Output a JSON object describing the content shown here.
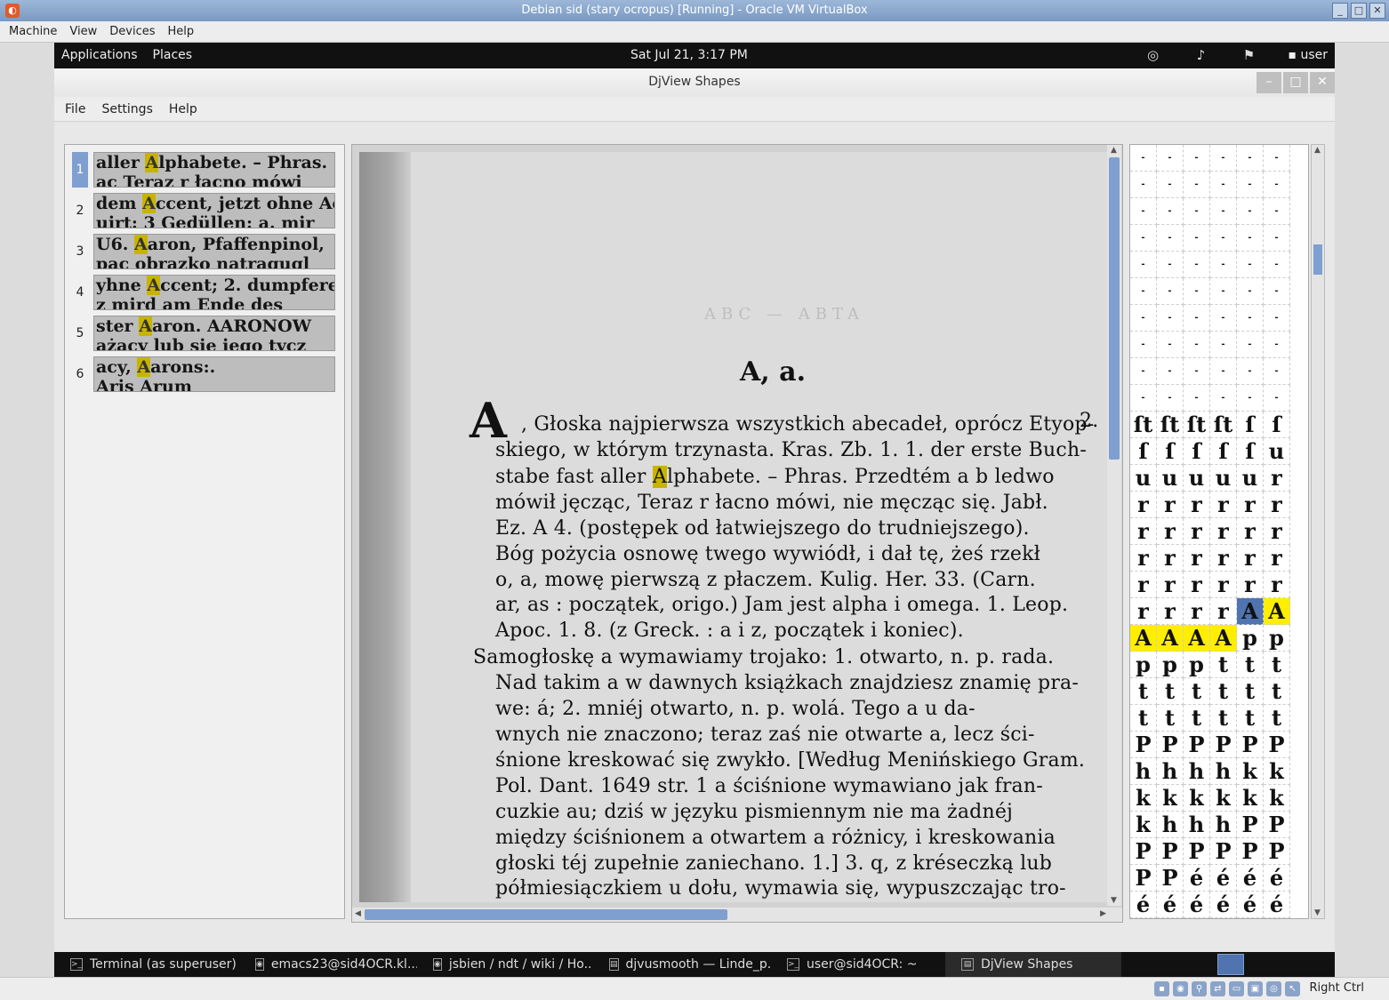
{
  "vbox": {
    "title": "Debian sid (stary ocropus) [Running] - Oracle VM VirtualBox",
    "menu": [
      "Machine",
      "View",
      "Devices",
      "Help"
    ],
    "host_key": "Right Ctrl"
  },
  "gnome": {
    "applications": "Applications",
    "places": "Places",
    "clock": "Sat Jul 21,  3:17 PM",
    "user": "user"
  },
  "window": {
    "title": "DjView Shapes",
    "menu": [
      "File",
      "Settings",
      "Help"
    ]
  },
  "thumbnails": [
    {
      "num": "1",
      "pre": "aller ",
      "hl": "A",
      "post": "lphabete. – Phras.",
      "line2": "ac Teraz r łacno mówi"
    },
    {
      "num": "2",
      "pre": "dem ",
      "hl": "A",
      "post": "ccent, jetzt ohne Ac",
      "line2": "uirt: 3 Gedüllen: a. mir"
    },
    {
      "num": "3",
      "pre": "U6. ",
      "hl": "A",
      "post": "aron, Pfaffenpinol,",
      "line2": "pac obrazko natragugl"
    },
    {
      "num": "4",
      "pre": "yhne ",
      "hl": "A",
      "post": "ccent; 2. dumpferee",
      "line2": "z mird am Ende des"
    },
    {
      "num": "5",
      "pre": "ster ",
      "hl": "A",
      "post": "aron. AARONOW",
      "line2": "ażacy lub sie iego tycz"
    },
    {
      "num": "6",
      "pre": "acy, ",
      "hl": "A",
      "post": "arons:.",
      "line2": " Aris  Arum"
    }
  ],
  "page": {
    "faint_header": "ABC — ABTA",
    "heading": "A, a.",
    "big_initial": "A",
    "side_num": "2.",
    "lines": [
      ", Głoska najpierwsza wszystkich abecadeł, oprócz Etyop-",
      "skiego, w którym trzynasta. Kras. Zb. 1. 1. der erste Buch-",
      "stabe fast aller ",
      "lphabete. – Phras. Przedtém a b ledwo",
      "mówił jęcząc, Teraz r łacno mówi, nie męcząc się. Jabł.",
      "Ez. A 4. (postępek od łatwiejszego do trudniejszego).",
      "Bóg pożycia osnowę twego wywiódł, i dał tę, żeś rzekł",
      "o, a, mowę pierwszą z płaczem. Kulig. Her. 33. (Carn.",
      "ar, as : początek, origo.) Jam jest alpha i omega. 1. Leop.",
      "Apoc. 1. 8. (z Greck. : a i z, początek i koniec).",
      "Samogłoskę a wymawiamy trojako: 1. otwarto, n. p. rada.",
      "Nad takim a w dawnych książkach znajdziesz znamię pra-",
      "we: á; 2. mniéj otwarto, n. p. wolá. Tego a u da-",
      "wnych nie znaczono; teraz zaś nie otwarte a, lecz ści-",
      "śnione kreskować się zwykło. [Według Menińskiego Gram.",
      "Pol. Dant. 1649 str. 1 a ściśnione wymawiano jak fran-",
      "cuzkie au; dziś w języku pismiennym nie ma żadnéj",
      "między ściśnionem a otwartem a różnicy, i kreskowania",
      "głoski téj zupełnie zaniechano. 1.] 3. q, z kréseczką lub",
      "półmiesiączkiem u dołu, wymawia się, wypuszczając tro-"
    ],
    "hl_letter": "A"
  },
  "shapes": {
    "rows": [
      [
        "-",
        "-",
        "-",
        "-",
        "-",
        "-"
      ],
      [
        "-",
        "-",
        "-",
        "-",
        "-",
        "-"
      ],
      [
        "-",
        "-",
        "-",
        "-",
        "-",
        "-"
      ],
      [
        "-",
        "-",
        "-",
        "-",
        "-",
        "-"
      ],
      [
        "-",
        "-",
        "-",
        "-",
        "-",
        "-"
      ],
      [
        "-",
        "-",
        "-",
        "-",
        "-",
        "-"
      ],
      [
        "-",
        "-",
        "-",
        "-",
        "-",
        "-"
      ],
      [
        "-",
        "-",
        "-",
        "-",
        "-",
        "-"
      ],
      [
        "-",
        "-",
        "-",
        "-",
        "-",
        "-"
      ],
      [
        "-",
        "-",
        "-",
        "-",
        "-",
        "-"
      ],
      [
        "ſt",
        "ſt",
        "ſt",
        "ſt",
        "ſ",
        "ſ"
      ],
      [
        "ſ",
        "ſ",
        "ſ",
        "ſ",
        "ſ",
        "u"
      ],
      [
        "u",
        "u",
        "u",
        "u",
        "u",
        "r"
      ],
      [
        "r",
        "r",
        "r",
        "r",
        "r",
        "r"
      ],
      [
        "r",
        "r",
        "r",
        "r",
        "r",
        "r"
      ],
      [
        "r",
        "r",
        "r",
        "r",
        "r",
        "r"
      ],
      [
        "r",
        "r",
        "r",
        "r",
        "r",
        "r"
      ],
      [
        "r",
        "r",
        "r",
        "r",
        "A",
        "A"
      ],
      [
        "A",
        "A",
        "A",
        "A",
        "p",
        "p"
      ],
      [
        "p",
        "p",
        "p",
        "t",
        "t",
        "t"
      ],
      [
        "t",
        "t",
        "t",
        "t",
        "t",
        "t"
      ],
      [
        "t",
        "t",
        "t",
        "t",
        "t",
        "t"
      ],
      [
        "P",
        "P",
        "P",
        "P",
        "P",
        "P"
      ],
      [
        "h",
        "h",
        "h",
        "h",
        "k",
        "k"
      ],
      [
        "k",
        "k",
        "k",
        "k",
        "k",
        "k"
      ],
      [
        "k",
        "h",
        "h",
        "h",
        "P",
        "P"
      ],
      [
        "P",
        "P",
        "P",
        "P",
        "P",
        "P"
      ],
      [
        "P",
        "P",
        "é",
        "é",
        "é",
        "é"
      ],
      [
        "é",
        "é",
        "é",
        "é",
        "é",
        "é"
      ]
    ]
  },
  "taskbar": [
    {
      "icon": ">_",
      "label": "Terminal (as superuser)"
    },
    {
      "icon": "◉",
      "label": "emacs23@sid4OCR.kl..."
    },
    {
      "icon": "◉",
      "label": "jsbien / ndt / wiki / Ho..."
    },
    {
      "icon": "▤",
      "label": "djvusmooth — Linde_p..."
    },
    {
      "icon": ">_",
      "label": "user@sid4OCR: ~"
    },
    {
      "icon": "▤",
      "label": "DjView Shapes"
    }
  ]
}
